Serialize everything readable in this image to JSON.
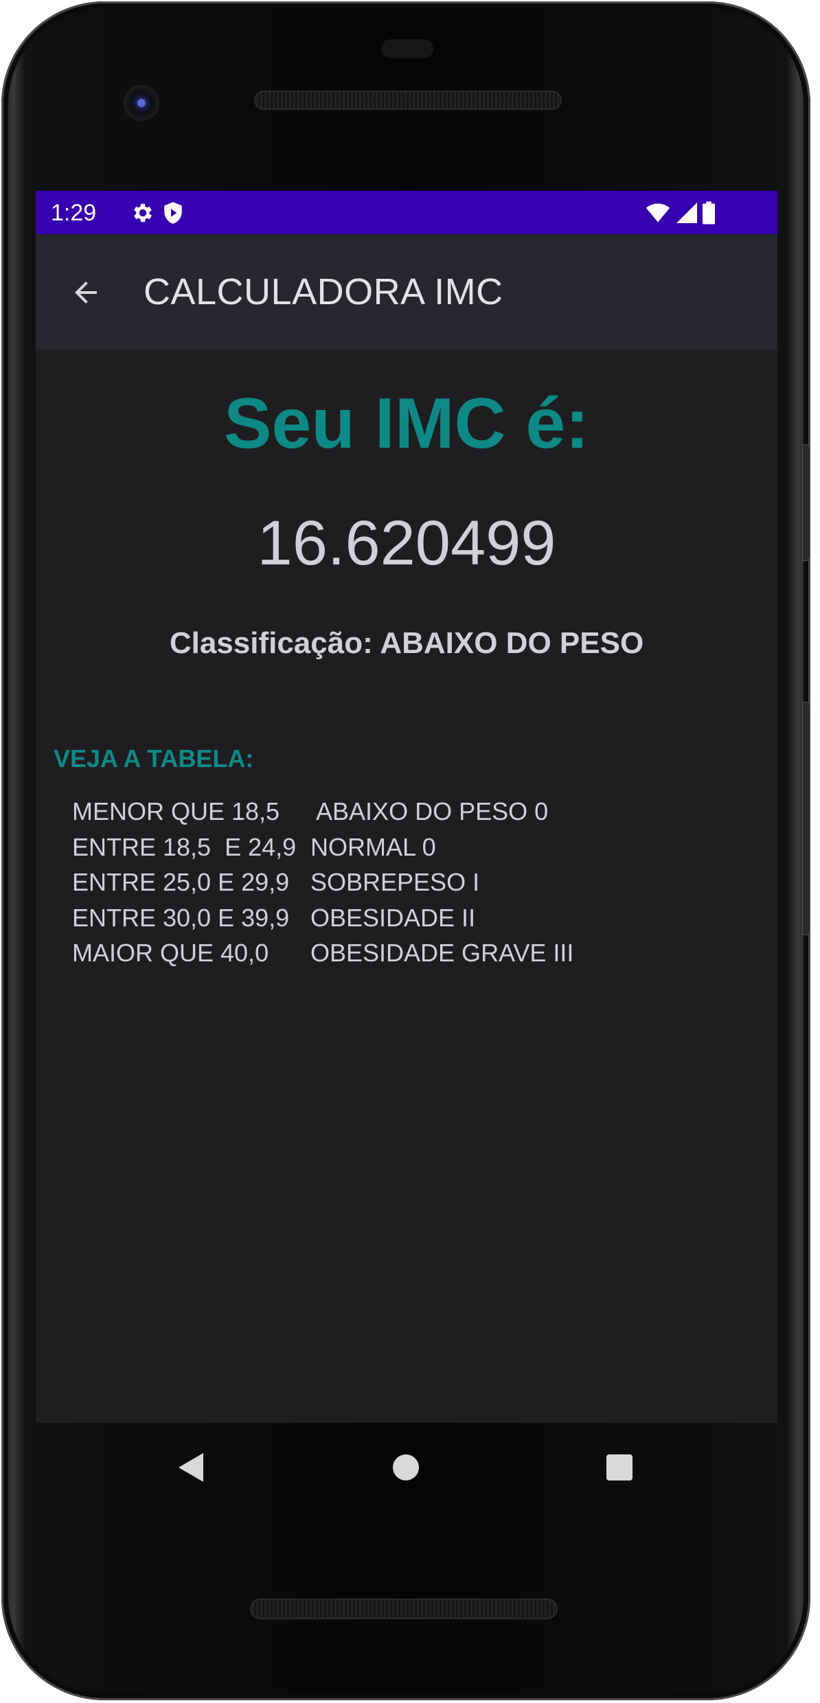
{
  "status_bar": {
    "time": "1:29",
    "icons": [
      "gear-icon",
      "shield-icon",
      "wifi-icon",
      "cell-signal-icon",
      "battery-icon"
    ],
    "color": "#3700b3"
  },
  "app_bar": {
    "title": "CALCULADORA IMC",
    "back_icon": "arrow-back-icon",
    "color": "#28262f"
  },
  "result": {
    "heading": "Seu IMC é:",
    "value": "16.620499",
    "classification": "Classificação: ABAIXO DO PESO",
    "accent_color": "#0e8a86"
  },
  "table": {
    "heading": "VEJA A TABELA:",
    "rows": [
      {
        "range": "MENOR QUE 18,5",
        "class": " ABAIXO DO PESO 0"
      },
      {
        "range": "ENTRE 18,5  E 24,9",
        "class": "NORMAL 0"
      },
      {
        "range": "ENTRE 25,0 E 29,9",
        "class": "SOBREPESO I"
      },
      {
        "range": "ENTRE 30,0 E 39,9",
        "class": "OBESIDADE II"
      },
      {
        "range": "MAIOR QUE 40,0",
        "class": "OBESIDADE GRAVE III"
      }
    ]
  },
  "nav_bar": {
    "buttons": [
      "back-triangle-icon",
      "home-circle-icon",
      "recents-square-icon"
    ]
  }
}
